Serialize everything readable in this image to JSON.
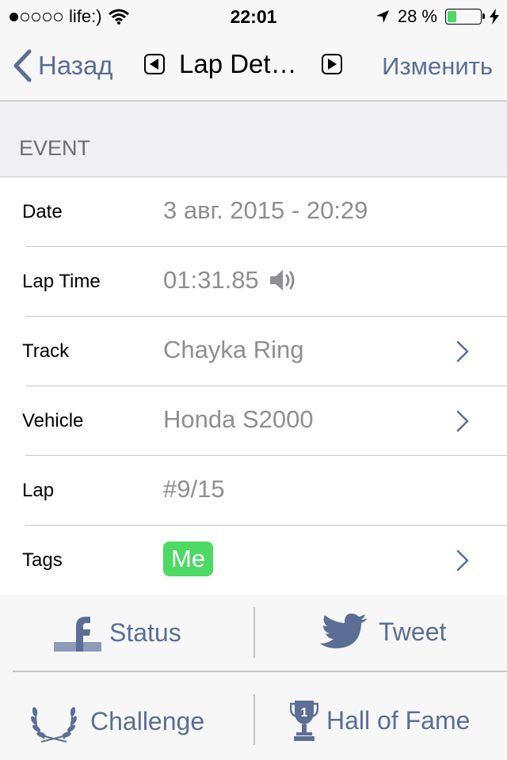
{
  "status_bar": {
    "carrier": "life:)",
    "time": "22:01",
    "battery_percent": "28 %",
    "battery_level": 0.28,
    "signal_bars": 1
  },
  "nav": {
    "back_label": "Назад",
    "title": "Lap Det…",
    "edit_label": "Изменить"
  },
  "section": {
    "header": "EVENT"
  },
  "rows": [
    {
      "label": "Date",
      "value": "3 авг. 2015 - 20:29"
    },
    {
      "label": "Lap Time",
      "value": "01:31.85"
    },
    {
      "label": "Track",
      "value": "Chayka Ring"
    },
    {
      "label": "Vehicle",
      "value": "Honda S2000"
    },
    {
      "label": "Lap",
      "value": "#9/15"
    },
    {
      "label": "Tags",
      "value": "Me"
    }
  ],
  "actions": {
    "status": "Status",
    "tweet": "Tweet",
    "challenge": "Challenge",
    "hall_of_fame": "Hall of Fame"
  },
  "colors": {
    "accent": "#5a6e96",
    "tag_green": "#4cd964",
    "value_gray": "#8e8e93"
  },
  "icons": [
    "chevron-left-icon",
    "triangle-left-icon",
    "triangle-right-icon",
    "speaker-icon",
    "chevron-right-icon",
    "facebook-icon",
    "twitter-bird-icon",
    "laurel-icon",
    "trophy-icon",
    "wifi-icon",
    "location-arrow-icon",
    "battery-icon",
    "charging-bolt-icon"
  ]
}
